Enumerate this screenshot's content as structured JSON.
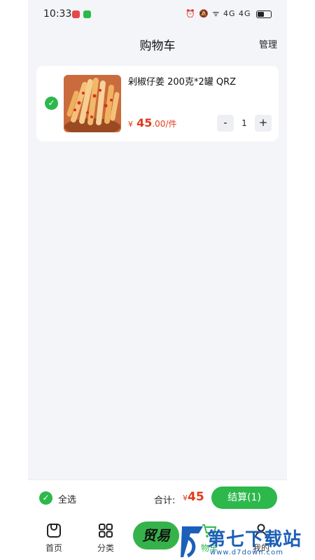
{
  "status_bar": {
    "time": "10:33",
    "right_icons": "⏰ 🔕 ᯤ 4G 4G",
    "app_colors": [
      "#e5484d",
      "#2db84b"
    ]
  },
  "header": {
    "title": "购物车",
    "manage_label": "管理"
  },
  "cart": {
    "items": [
      {
        "name": "剁椒仔姜 200克*2罐 QRZ",
        "price_symbol": "¥",
        "price_int": "45",
        "price_dec": ".00/件",
        "quantity": "1",
        "minus_label": "-",
        "plus_label": "+",
        "checked": true
      }
    ]
  },
  "bottom_bar": {
    "select_all_label": "全选",
    "total_label": "合计:",
    "total_symbol": "¥",
    "total_value": "45",
    "checkout_label": "结算(1)"
  },
  "tabbar": {
    "tabs": [
      {
        "label": "首页",
        "icon": "home-icon"
      },
      {
        "label": "分类",
        "icon": "category-icon"
      },
      {
        "label": "",
        "icon": "trade-icon"
      },
      {
        "label": "物车",
        "icon": "cart-icon"
      },
      {
        "label": "我的",
        "icon": "profile-icon"
      }
    ]
  },
  "watermark": {
    "badge": "贸易",
    "site_name": "第七下载站",
    "url": "www.d7down.com"
  },
  "colors": {
    "accent": "#2db84b",
    "price": "#e23a1c",
    "background": "#f4f5f9",
    "watermark_blue": "#1c5fb8"
  }
}
